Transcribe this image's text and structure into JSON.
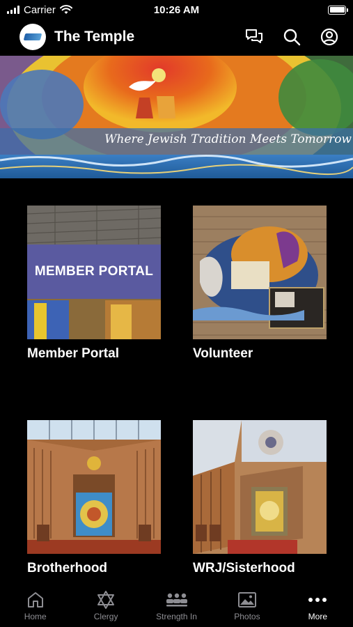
{
  "status_bar": {
    "carrier": "Carrier",
    "time": "10:26 AM"
  },
  "header": {
    "title": "The Temple",
    "icons": [
      "chat-icon",
      "search-icon",
      "account-icon"
    ]
  },
  "banner": {
    "tagline": "Where Jewish Tradition Meets Tomorrow"
  },
  "tiles": [
    {
      "label": "Member Portal",
      "image_text": "MEMBER PORTAL"
    },
    {
      "label": "Volunteer"
    },
    {
      "label": "Brotherhood"
    },
    {
      "label": "WRJ/Sisterhood"
    }
  ],
  "tabbar": {
    "items": [
      {
        "label": "Home",
        "icon": "home-icon"
      },
      {
        "label": "Clergy",
        "icon": "star-of-david-icon"
      },
      {
        "label": "Strength In",
        "icon": "group-icon"
      },
      {
        "label": "Photos",
        "icon": "photo-icon"
      },
      {
        "label": "More",
        "icon": "more-icon"
      }
    ],
    "active": "More"
  },
  "colors": {
    "background": "#000000",
    "accent": "#ffffff",
    "inactive_tab": "#8e8e93",
    "portal_band": "#5a5aa0"
  }
}
